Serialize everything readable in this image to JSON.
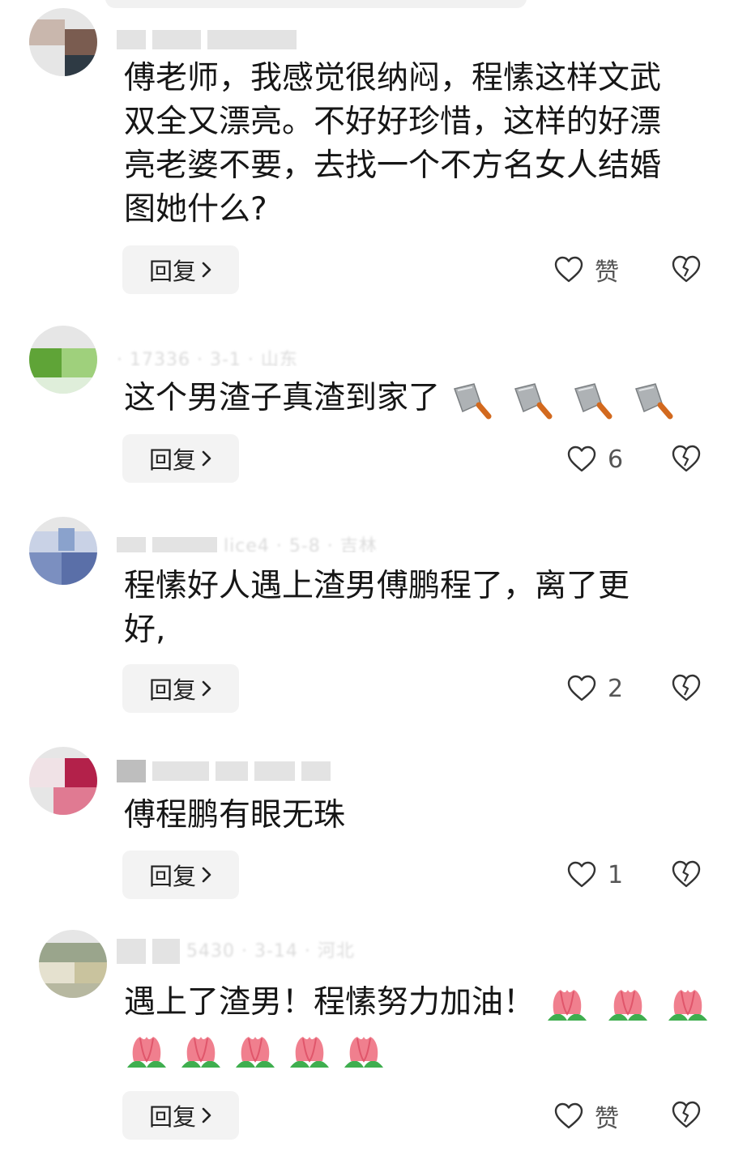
{
  "actions": {
    "reply_label": "回复"
  },
  "comments": [
    {
      "text": "傅老师，我感觉很纳闷，程愫这样文武双全又漂亮。不好好珍惜，这样的好漂亮老婆不要，去找一个不方名女人结婚图她什么?",
      "like_label": "赞",
      "avatar_colors": [
        "#8a6e62",
        "#b8a8a0",
        "#2e3a44"
      ]
    },
    {
      "text": "这个男渣子真渣到家了",
      "emojis": [
        "kitchen-knife",
        "kitchen-knife",
        "kitchen-knife",
        "kitchen-knife"
      ],
      "like_label": "6",
      "avatar_colors": [
        "#5fa437",
        "#9fd07c",
        "#e4ecdd"
      ]
    },
    {
      "text": "程愫好人遇上渣男傅鹏程了，离了更好,",
      "like_label": "2",
      "avatar_colors": [
        "#5a6fa8",
        "#8aa2cc",
        "#c9d2e6"
      ]
    },
    {
      "text": "傅程鹏有眼无珠",
      "like_label": "1",
      "avatar_colors": [
        "#b3214a",
        "#e07a92",
        "#f0e2e6"
      ]
    },
    {
      "text": "遇上了渣男！程愫努力加油！",
      "emojis_inline": [
        "tulip",
        "tulip",
        "tulip"
      ],
      "emojis_line": [
        "tulip",
        "tulip",
        "tulip",
        "tulip",
        "tulip"
      ],
      "like_label": "赞",
      "avatar_colors": [
        "#9aa58c",
        "#c9c39e",
        "#e5e1cf"
      ]
    }
  ]
}
